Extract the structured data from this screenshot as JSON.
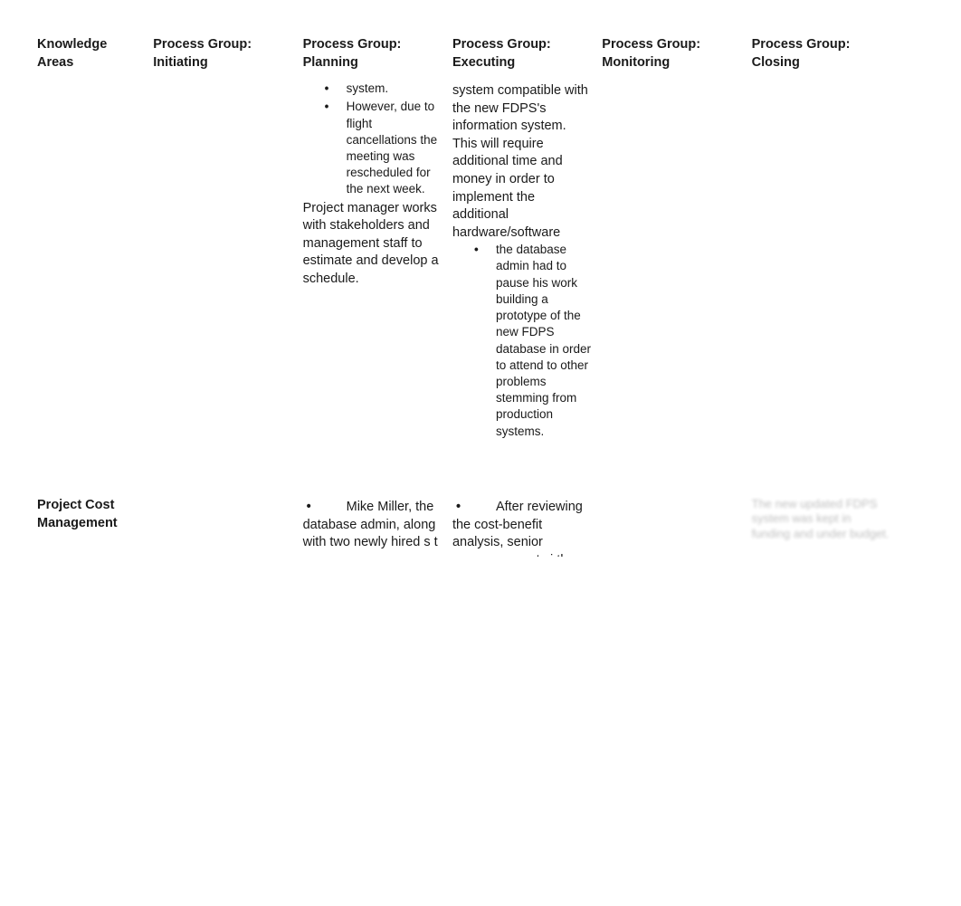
{
  "headers": {
    "knowledge_areas": "Knowledge Areas",
    "pg_initiating": "Process Group: Initiating",
    "pg_planning": "Process Group: Planning",
    "pg_executing": "Process Group: Executing",
    "pg_monitoring": "Process Group: Monitoring",
    "pg_closing": "Process Group: Closing"
  },
  "row1": {
    "label": "",
    "planning": {
      "bullet_tail": "system.",
      "bullet_2": "However, due to flight cancellations the meeting was rescheduled for the next week.",
      "para": "Project manager works with stakeholders and management staff to estimate and develop a schedule."
    },
    "executing": {
      "para_top": "system compatible with the new FDPS's information system. This will require additional time and money in order to implement the additional hardware/software",
      "bullet_1": "the database admin had to pause his work building a prototype of the new FDPS database in order to attend to other problems stemming from production systems."
    }
  },
  "row2": {
    "label": "Project Cost Management",
    "planning": {
      "lead": "Mike Miller, the database admin, along with two newly hired  s t"
    },
    "executing": {
      "lead": "After reviewing the cost-benefit analysis, senior manangemen t  si  th"
    },
    "closing": {
      "faded": "The new updated FDPS system was kept in funding and under budget."
    }
  }
}
